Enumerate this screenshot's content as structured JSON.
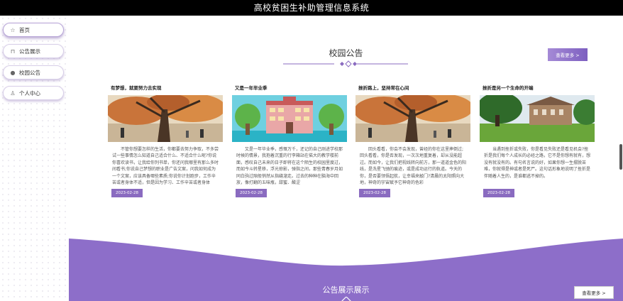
{
  "app": {
    "title": "高校贫困生补助管理信息系统"
  },
  "sidebar": {
    "items": [
      {
        "label": "首页",
        "icon": "star-icon"
      },
      {
        "label": "公告展示",
        "icon": "bag-icon"
      },
      {
        "label": "校园公告",
        "icon": "info-icon"
      },
      {
        "label": "个人中心",
        "icon": "user-icon"
      }
    ]
  },
  "notices": {
    "title": "校园公告",
    "more_label": "查看更多 >",
    "cards": [
      {
        "title": "有梦想，就要努力去实现",
        "text": "不管你想要怎样的生活，你都要去努力争取，不多尝试一些事情怎么知道自己适合什么、不适合什么呢?你说你喜欢读书，让我给你列书单，你还问我哪里有那么多时间看书;你说自己梦想的职业是广告文案，问我如何成为一个文案，应该具备哪些素质;你说你计划跑步，工作辛苦或者身体不适，但是因为学习、工作辛苦或者身体",
        "date": "2023-02-28",
        "image": "campus-tree"
      },
      {
        "title": "又是一年毕业季",
        "text": "又是一年毕业季，感慨万千，还记的自己刚进学校那时候的情景，我抱着沉重的行李箱站在偌大的教学楼前面，感叹自己未来的日子即将在这个陌生的校园里度过，而如今斗转星移，浮光掠影，弹指之间，那些青春岁月如同白驹过隙般悄然从指缝溜走。过去的种种在脑海中回放，像打翻的五味瓶，甜蜜、酸涩",
        "date": "2023-02-28",
        "image": "school-building"
      },
      {
        "title": "挫折路上，坚持常在心间",
        "text": "回头看看，你会不会发现，曾经的你在这里摔倒过;回头看看，你是否发现，一次次地重复着，却从没能超过。而如今，让我们把视线转向前方，那一道道金色的阳线，是洗星飞驰的痕迹，或是成功运行的轨道。今天的你，是否要领悟起航，让幸福来敲门?清晨的太阳照向大地，神奇的宇宙赋予它神奇的色彩",
        "date": "2023-02-28",
        "image": "campus-tree"
      },
      {
        "title": "挫折是另一个生命的开端",
        "text": "当遇到挫折或失败，你是看见失败还是看见机会?挫折是我们每个人成长的必经之路，它不是你想有就有，想没有就没有的。有句名言说的好，如果你想一生摆脱苦难，你就得是神或者是死尸。这句话形象地说明了挫折是伴随着人生的，是谁都逃不掉的。",
        "date": "2023-02-28",
        "image": "campus-lawn"
      }
    ]
  },
  "showcase": {
    "title": "公告展示展示",
    "more_label": "查看更多 >"
  },
  "colors": {
    "accent": "#8a6bc0",
    "wave": "#8d6ec9"
  }
}
